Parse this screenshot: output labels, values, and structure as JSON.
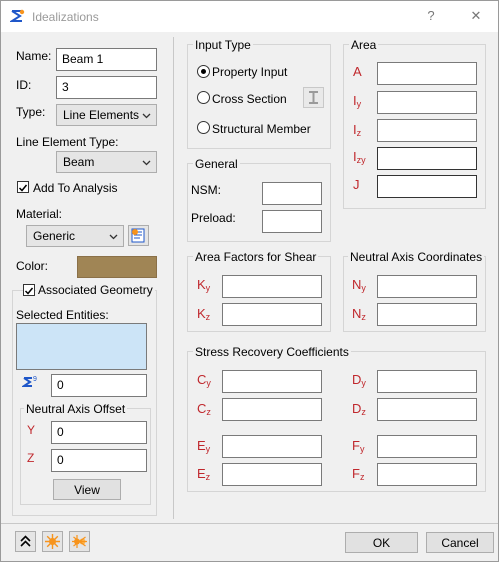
{
  "window": {
    "title": "Idealizations",
    "help": "?",
    "close": "✕"
  },
  "left": {
    "name_label": "Name:",
    "name_value": "Beam 1",
    "id_label": "ID:",
    "id_value": "3",
    "type_label": "Type:",
    "type_value": "Line Elements",
    "line_element_type_label": "Line Element Type:",
    "line_element_type_value": "Beam",
    "add_to_analysis_label": "Add To Analysis",
    "add_to_analysis_checked": true,
    "material_label": "Material:",
    "material_value": "Generic",
    "color_label": "Color:",
    "color_value": "#a08555",
    "associated_geometry_label": "Associated Geometry",
    "associated_geometry_checked": true,
    "selected_entities_label": "Selected Entities:",
    "selected_entities_bg": "#cce4f7",
    "entity_count_value": "0",
    "neutral_axis_offset": {
      "title": "Neutral Axis Offset",
      "y_label": "Y",
      "y_value": "0",
      "z_label": "Z",
      "z_value": "0",
      "view_button": "View"
    }
  },
  "input_type": {
    "title": "Input Type",
    "options": [
      "Property Input",
      "Cross Section",
      "Structural Member"
    ],
    "selected": "Property Input"
  },
  "general": {
    "title": "General",
    "nsm_label": "NSM:",
    "preload_label": "Preload:"
  },
  "area": {
    "title": "Area",
    "rows": [
      {
        "sym": "A",
        "sub": ""
      },
      {
        "sym": "I",
        "sub": "y"
      },
      {
        "sym": "I",
        "sub": "z"
      },
      {
        "sym": "I",
        "sub": "zy"
      },
      {
        "sym": "J",
        "sub": ""
      }
    ]
  },
  "area_factors": {
    "title": "Area Factors for Shear",
    "rows": [
      {
        "sym": "K",
        "sub": "y"
      },
      {
        "sym": "K",
        "sub": "z"
      }
    ]
  },
  "neutral_axis_coords": {
    "title": "Neutral Axis Coordinates",
    "rows": [
      {
        "sym": "N",
        "sub": "y"
      },
      {
        "sym": "N",
        "sub": "z"
      }
    ]
  },
  "stress_recovery": {
    "title": "Stress Recovery Coefficients",
    "left": [
      {
        "sym": "C",
        "sub": "y"
      },
      {
        "sym": "C",
        "sub": "z"
      },
      {
        "sym": "E",
        "sub": "y"
      },
      {
        "sym": "E",
        "sub": "z"
      }
    ],
    "right": [
      {
        "sym": "D",
        "sub": "y"
      },
      {
        "sym": "D",
        "sub": "z"
      },
      {
        "sym": "F",
        "sub": "y"
      },
      {
        "sym": "F",
        "sub": "z"
      }
    ]
  },
  "footer": {
    "ok": "OK",
    "cancel": "Cancel"
  },
  "colors": {
    "label_red": "#c0282d",
    "accent_orange": "#f7941d"
  }
}
